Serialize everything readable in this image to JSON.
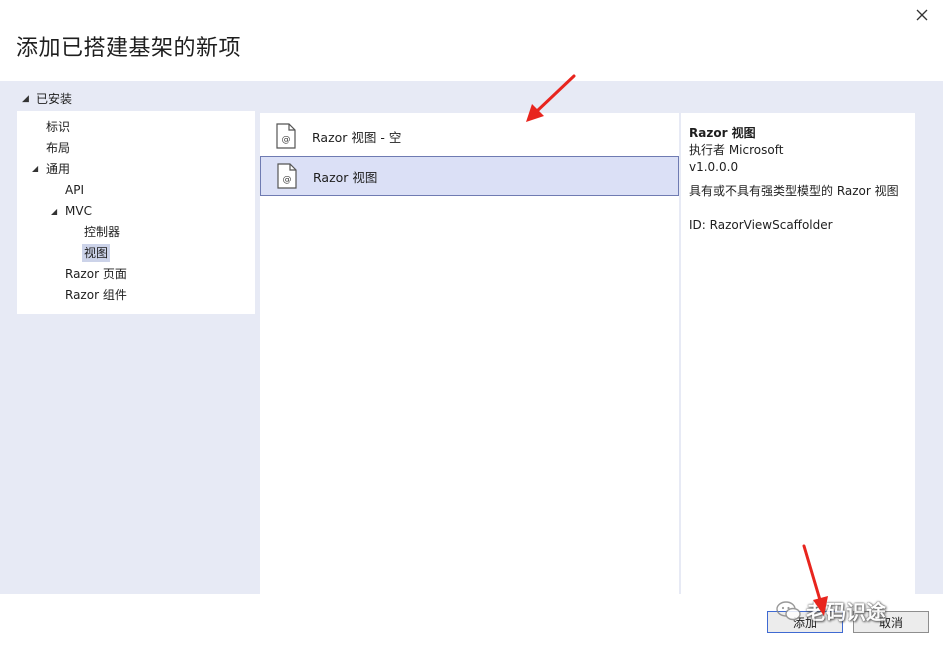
{
  "dialog": {
    "title": "添加已搭建基架的新项"
  },
  "left_panel": {
    "installed_label": "已安装",
    "tree": [
      {
        "label": "标识",
        "level": 1
      },
      {
        "label": "布局",
        "level": 1
      },
      {
        "label": "通用",
        "level": 0,
        "expanded": true
      },
      {
        "label": "API",
        "level": 2
      },
      {
        "label": "MVC",
        "level": 1,
        "expanded": true
      },
      {
        "label": "控制器",
        "level": 3
      },
      {
        "label": "视图",
        "level": 3,
        "selected": true
      },
      {
        "label": "Razor 页面",
        "level": 2
      },
      {
        "label": "Razor 组件",
        "level": 2
      }
    ]
  },
  "templates": [
    {
      "label": "Razor 视图 - 空",
      "selected": false
    },
    {
      "label": "Razor 视图",
      "selected": true
    }
  ],
  "details": {
    "name": "Razor 视图",
    "author": "执行者 Microsoft",
    "version": "v1.0.0.0",
    "description": "具有或不具有强类型模型的 Razor 视图",
    "id": "ID: RazorViewScaffolder"
  },
  "buttons": {
    "add": "添加",
    "cancel": "取消"
  },
  "watermark": {
    "text": "老码识途"
  },
  "colors": {
    "selection_fill": "#dbe0f6",
    "selection_border": "#6f7bb2",
    "panel_background": "#e7eaf5",
    "annotation_arrow": "#e8251e"
  },
  "icons": {
    "close": "close-icon",
    "template": "razor-file-icon",
    "watermark": "wechat-icon"
  }
}
